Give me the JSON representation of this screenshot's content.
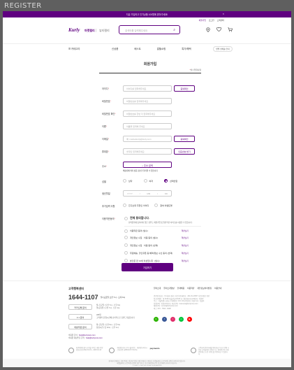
{
  "window": {
    "title": "REGISTER"
  },
  "banner": {
    "text": "지금 가입하고 인기상품 100원에 받아가세요!",
    "close": "×"
  },
  "header": {
    "util": {
      "signup": "회원가입",
      "login": "로그인",
      "cs": "고객센터"
    },
    "logo": "Kurly",
    "brand_a": "마켓컬리",
    "brand_b": "뷰티컬리",
    "search_placeholder": "검색어를 입력해주세요"
  },
  "gnb": {
    "category": "카테고리",
    "menu": [
      "신상품",
      "베스트",
      "알뜰쇼핑",
      "특가/혜택"
    ],
    "delivery_pill": "샛별·낮배송 안내"
  },
  "form": {
    "title": "회원가입",
    "required_note_mark": "*",
    "required_note": "필수입력사항",
    "fields": [
      {
        "label": "아이디",
        "placeholder": "아이디를 입력해주세요",
        "button": "중복확인"
      },
      {
        "label": "비밀번호",
        "placeholder": "비밀번호를 입력해주세요"
      },
      {
        "label": "비밀번호 확인",
        "placeholder": "비밀번호를 한번 더 입력해주세요"
      },
      {
        "label": "이름",
        "placeholder": "이름을 입력해 주세요"
      },
      {
        "label": "이메일",
        "placeholder": "예: marketkurly@kurly.com",
        "button": "중복확인"
      },
      {
        "label": "휴대폰",
        "placeholder": "숫자만 입력해주세요.",
        "button": "인증번호 받기"
      }
    ],
    "address": {
      "label": "주소",
      "button": "주소 검색",
      "note": "배송지에 따라 상품 정보가 달라질 수 있습니다."
    },
    "gender": {
      "label": "성별",
      "options": [
        "남자",
        "여자",
        "선택안함"
      ],
      "selected_index": 2
    },
    "birthday": {
      "label": "생년월일",
      "yyyy": "YYYY",
      "mm": "MM",
      "dd": "DD"
    },
    "extra": {
      "label": "추가입력 사항",
      "options": [
        "친구초대 추천인 아이디",
        "참여 이벤트명"
      ]
    },
    "terms": {
      "label": "이용약관동의",
      "all": "전체 동의합니다.",
      "all_sub": "선택항목에 동의하지 않은 경우도 회원가입 및 일반적인 서비스를 이용할 수 있습니다.",
      "items": [
        {
          "text": "이용약관 동의 (필수)",
          "view": "약관보기"
        },
        {
          "text": "개인정보 수집 · 이용 동의 (필수)",
          "view": "약관보기"
        },
        {
          "text": "개인정보 수집 · 이용 동의 (선택)",
          "view": "약관보기"
        },
        {
          "text": "무료배송, 할인쿠폰 등 혜택/정보 수신 동의 (선택)",
          "view": "약관보기"
        },
        {
          "text": "본인은 만 14세 이상입니다. (필수)",
          "view": "약관보기"
        }
      ]
    },
    "submit": "가입하기"
  },
  "footer": {
    "cs_title": "고객행복센터",
    "phone": "1644-1107",
    "phone_note": "월~토요일 오전 7시 - 오후 6시",
    "cs_rows": [
      {
        "button": "카카오톡 문의",
        "desc": "월~토요일 | 오전 7시 - 오후 6시\n일/공휴일 | 오전 7시 - 오후 1시"
      },
      {
        "button": "1:1 문의",
        "desc": "365일\n고객센터 운영시간에 순차적으로 답변드리겠습니다."
      },
      {
        "button": "대량주문 문의",
        "desc": "월~금요일 | 오전 9시 - 오후 6시\n점심시간 | 낮 12시 - 오후 1시"
      }
    ],
    "mail": {
      "label1": "비회원 문의 :",
      "mail1": "help@kurlycorp.com",
      "label2": "비회원 대량주문 문의 :",
      "mail2": "help@kurlycorp.com"
    },
    "links": [
      "컬리소개",
      "컬리소개영상",
      "인재채용",
      "이용약관",
      "개인정보처리방침",
      "이용안내"
    ],
    "info": "법인명 (상호) : 주식회사 컬리 | 사업자등록번호 : 261-81-23567 사업자정보 확인\n통신판매업 : 제 2018-서울강남-01646 호 | 개인정보보호책임자 : 이원준\n주소 : 서울특별시 강남구 테헤란로 133, 18층(역삼동) | 대표이사 : 김슬아\n입점문의 : 입점문의하기 | 제휴문의 : business@kurlycorp.com\n채용문의 : recruit@kurlycorp.com\n팩스: 070 - 7500 - 6098",
    "social": [
      {
        "name": "blog",
        "label": "b",
        "color": "#2db400"
      },
      {
        "name": "facebook",
        "label": "f",
        "color": "#3b5998"
      },
      {
        "name": "instagram",
        "label": "i",
        "color": "#e1306c"
      },
      {
        "name": "naver-post",
        "label": "n",
        "color": "#00c73c"
      },
      {
        "name": "youtube",
        "label": "▶",
        "color": "#ff0000"
      }
    ],
    "certs": [
      "[인증범위] 컬리 쇼핑몰 서비스 개발·운영\n[유효기간] 2022.01.19 ~ 2025.01.18",
      "개인정보보호 우수 웹사이트 · 개인정보처리시스템 인증 (ePRIVACY PLUS)",
      "payments",
      "고객님의 안전거래를 위해 현금 등으로 결제 시 저희 쇼핑몰에서 가입한 토스 페이먼츠의 구매안전(에스크로) 서비스를 이용하실 수 있습니다."
    ],
    "copyright": "컬리에서 판매되는 상품 중에는 컬리에 입점한 개별 판매자가 판매하는 마켓플레이스(오픈마켓) 상품이 포함되어 있습니다.\n마켓플레이스(오픈마켓) 상품의 경우 컬리는 통신판매중개자로서 통신판매의 당사자가 아닙니다.\n© KURLY CORP. ALL RIGHTS RESERVED"
  },
  "colors": {
    "brand": "#5f0080",
    "required": "#ee6a7b"
  }
}
